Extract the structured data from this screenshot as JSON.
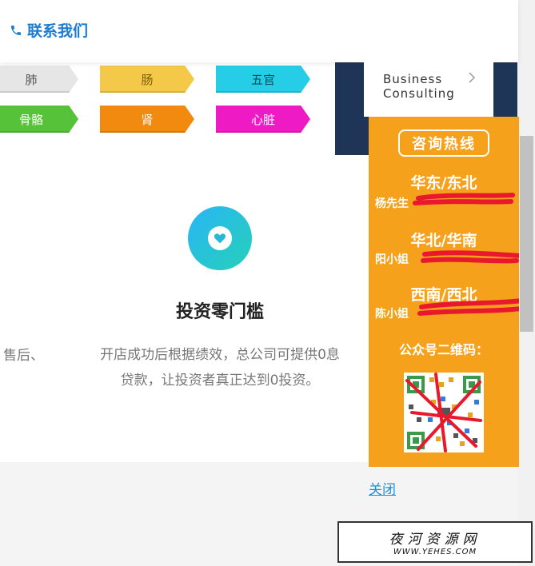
{
  "header": {
    "contact_label": "联系我们",
    "accent_color": "#1a7dd1"
  },
  "tags": [
    {
      "label": "肺",
      "color": "#e6e6e6",
      "text_color": "#555555"
    },
    {
      "label": "肠",
      "color": "#f4c94a",
      "text_color": "#7a5a00"
    },
    {
      "label": "五官",
      "color": "#25cde6",
      "text_color": "#0b4e5a"
    },
    {
      "label": "骨骼",
      "color": "#55c23a",
      "text_color": "#ffffff"
    },
    {
      "label": "肾",
      "color": "#f18a0f",
      "text_color": "#ffffff"
    },
    {
      "label": "心脏",
      "color": "#ee1bc4",
      "text_color": "#ffffff"
    }
  ],
  "business_card": {
    "line1": "Business",
    "line2": "Consulting"
  },
  "feature": {
    "icon": "heart-icon",
    "title": "投资零门槛",
    "left_fragment": "售后、",
    "line1": "开店成功后根据绩效，总公司可提供0息",
    "line2": "贷款，让投资者真正达到0投资。"
  },
  "hotline_panel": {
    "badge": "咨询热线",
    "regions": [
      {
        "name": "华东/东北",
        "contact": "杨先生"
      },
      {
        "name": "华北/华南",
        "contact": "阳小姐"
      },
      {
        "name": "西南/西北",
        "contact": "陈小姐"
      }
    ],
    "qr_title": "公众号二维码：",
    "panel_color": "#f5a11c"
  },
  "close_label": "关闭",
  "watermark": {
    "cn": "夜河资源网",
    "en": "WWW.YEHES.COM"
  }
}
